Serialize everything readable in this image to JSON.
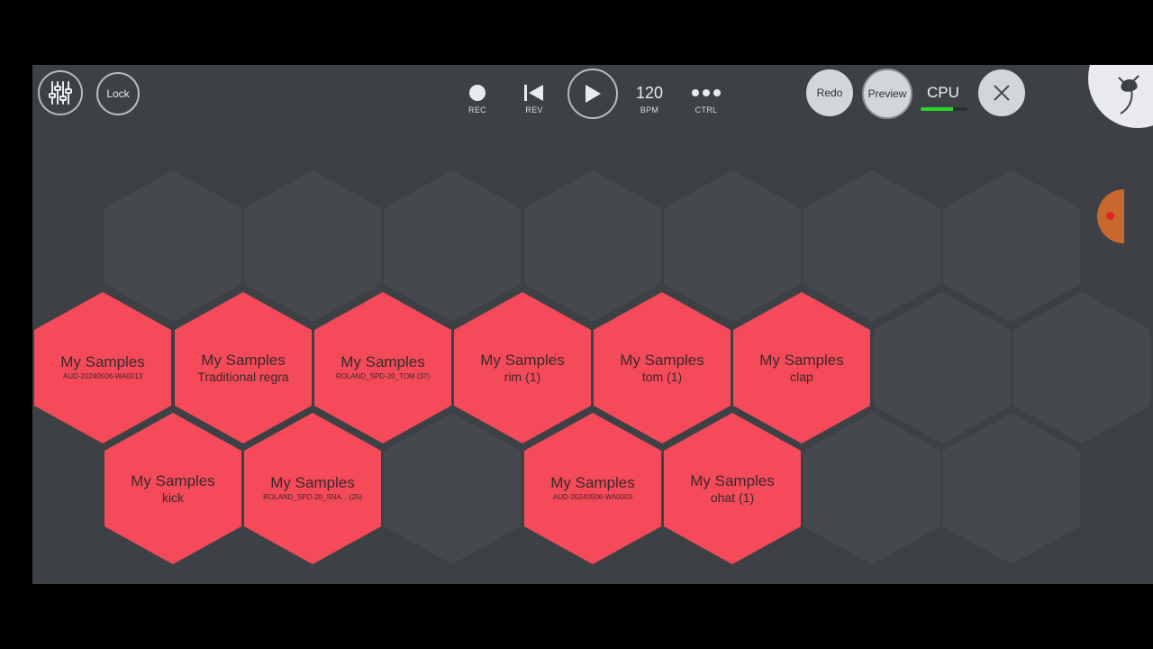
{
  "toolbar": {
    "mixer_icon": "mixer-sliders-icon",
    "lock_label": "Lock",
    "rec_label": "REC",
    "rev_label": "REV",
    "play_icon": "play-icon",
    "bpm_value": "120",
    "bpm_label": "BPM",
    "ctrl_label": "CTRL",
    "redo_label": "Redo",
    "preview_label": "Preview",
    "cpu_label": "CPU",
    "cpu_level": 0.7,
    "close_icon": "close-icon"
  },
  "colors": {
    "background": "#3d4145",
    "pad_filled": "#f44a59",
    "pad_empty": "#45494d",
    "cpu_meter": "#2ad52a"
  },
  "pads": [
    {
      "title": "My Samples",
      "subtitle": "AUD-20240506-WA0013",
      "small": true
    },
    {
      "title": "My Samples",
      "subtitle": "Traditional regra",
      "small": false
    },
    {
      "title": "My Samples",
      "subtitle": "ROLAND_SPD-20_TOM (37)",
      "small": true
    },
    {
      "title": "My Samples",
      "subtitle": "rim (1)",
      "small": false
    },
    {
      "title": "My Samples",
      "subtitle": "tom (1)",
      "small": false
    },
    {
      "title": "My Samples",
      "subtitle": "clap",
      "small": false
    },
    {
      "title": "My Samples",
      "subtitle": "kick",
      "small": false
    },
    {
      "title": "My Samples",
      "subtitle": "ROLAND_SPD-20_SNA... (25)",
      "small": true
    },
    {
      "title": "My Samples",
      "subtitle": "AUD-20240506-WA0003",
      "small": true
    },
    {
      "title": "My Samples",
      "subtitle": "ohat (1)",
      "small": false
    }
  ]
}
